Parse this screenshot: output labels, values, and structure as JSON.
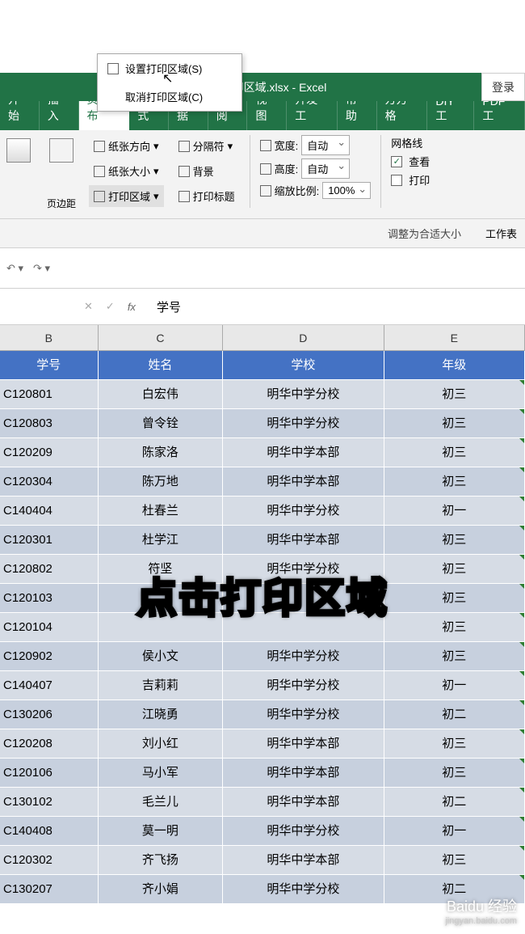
{
  "title": "设置打印区域.xlsx  -  Excel",
  "login": "登录",
  "tabs": [
    "开始",
    "插入",
    "页面布",
    "公式",
    "数据",
    "审阅",
    "视图",
    "开发工",
    "帮助",
    "方方格",
    "DIY工",
    "PDF工"
  ],
  "active_tab": 2,
  "ribbon": {
    "margins": "页边距",
    "orientation": "纸张方向",
    "size": "纸张大小",
    "print_area": "打印区域",
    "breaks": "分隔符",
    "background": "背景",
    "print_titles": "打印标题",
    "width_label": "宽度:",
    "width_value": "自动",
    "height_label": "高度:",
    "height_value": "自动",
    "scale_label": "缩放比例:",
    "scale_value": "100%",
    "fit_label": "调整为合适大小",
    "gridlines": "网格线",
    "view_chk": "查看",
    "print_chk": "打印",
    "sheet_opts": "工作表"
  },
  "dropdown": {
    "set_area": "设置打印区域(S)",
    "clear_area": "取消打印区域(C)"
  },
  "formula_bar": {
    "fx": "fx",
    "value": "学号"
  },
  "columns": [
    "B",
    "C",
    "D",
    "E"
  ],
  "headers": [
    "学号",
    "姓名",
    "学校",
    "年级"
  ],
  "rows": [
    {
      "id": "C120801",
      "name": "白宏伟",
      "school": "明华中学分校",
      "grade": "初三"
    },
    {
      "id": "C120803",
      "name": "曾令铨",
      "school": "明华中学分校",
      "grade": "初三"
    },
    {
      "id": "C120209",
      "name": "陈家洛",
      "school": "明华中学本部",
      "grade": "初三"
    },
    {
      "id": "C120304",
      "name": "陈万地",
      "school": "明华中学本部",
      "grade": "初三"
    },
    {
      "id": "C140404",
      "name": "杜春兰",
      "school": "明华中学分校",
      "grade": "初一"
    },
    {
      "id": "C120301",
      "name": "杜学江",
      "school": "明华中学本部",
      "grade": "初三"
    },
    {
      "id": "C120802",
      "name": "符坚",
      "school": "明华中学分校",
      "grade": "初三"
    },
    {
      "id": "C120103",
      "name": "",
      "school": "",
      "grade": "初三"
    },
    {
      "id": "C120104",
      "name": "",
      "school": "",
      "grade": "初三"
    },
    {
      "id": "C120902",
      "name": "侯小文",
      "school": "明华中学分校",
      "grade": "初三"
    },
    {
      "id": "C140407",
      "name": "吉莉莉",
      "school": "明华中学分校",
      "grade": "初一"
    },
    {
      "id": "C130206",
      "name": "江晓勇",
      "school": "明华中学分校",
      "grade": "初二"
    },
    {
      "id": "C120208",
      "name": "刘小红",
      "school": "明华中学本部",
      "grade": "初三"
    },
    {
      "id": "C120106",
      "name": "马小军",
      "school": "明华中学本部",
      "grade": "初三"
    },
    {
      "id": "C130102",
      "name": "毛兰儿",
      "school": "明华中学本部",
      "grade": "初二"
    },
    {
      "id": "C140408",
      "name": "莫一明",
      "school": "明华中学分校",
      "grade": "初一"
    },
    {
      "id": "C120302",
      "name": "齐飞扬",
      "school": "明华中学本部",
      "grade": "初三"
    },
    {
      "id": "C130207",
      "name": "齐小娟",
      "school": "明华中学分校",
      "grade": "初二"
    }
  ],
  "overlay": "点击打印区域",
  "watermark": {
    "brand": "Baidu 经验",
    "url": "jingyan.baidu.com"
  }
}
